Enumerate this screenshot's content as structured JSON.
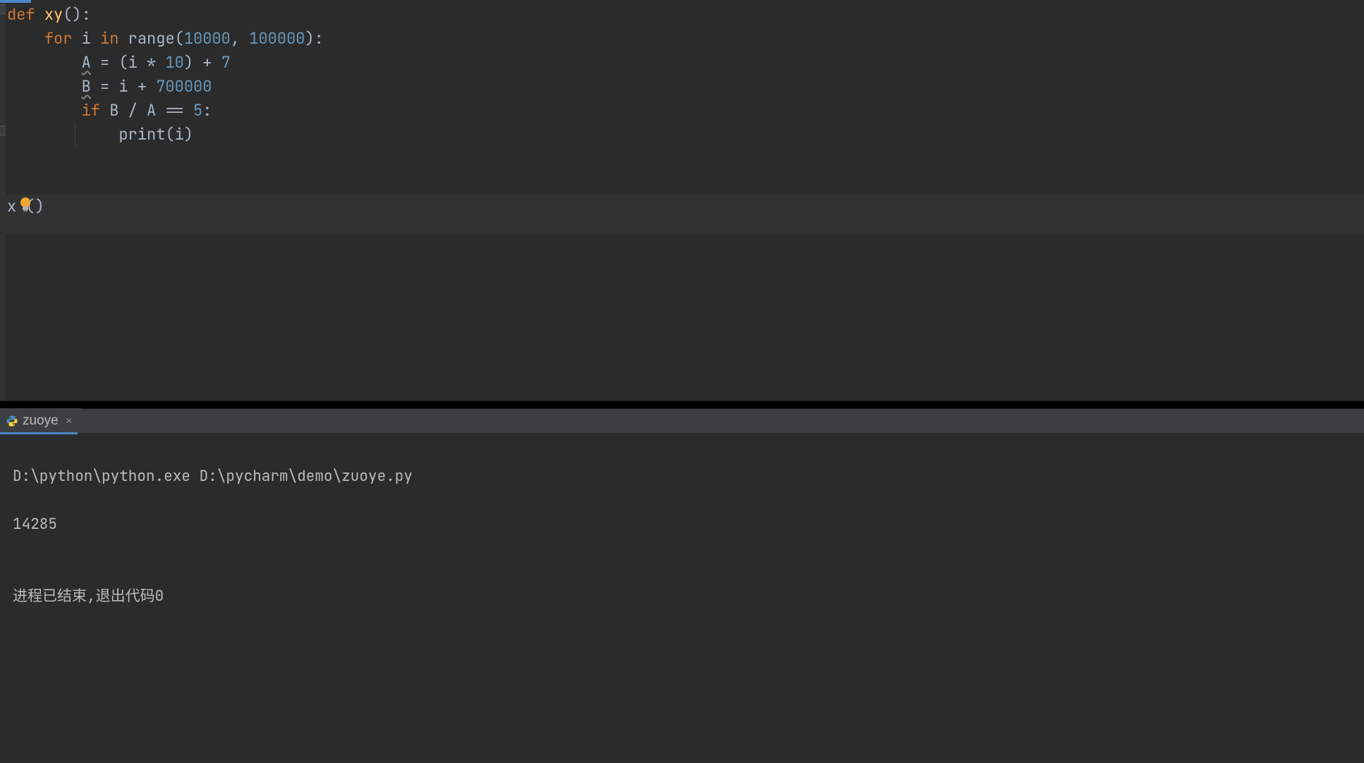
{
  "editor": {
    "code_tokens": [
      [
        {
          "t": "def ",
          "c": "kw"
        },
        {
          "t": "xy",
          "c": "fn"
        },
        {
          "t": "():",
          "c": "var"
        }
      ],
      [
        {
          "t": "    ",
          "c": "var"
        },
        {
          "t": "for ",
          "c": "kw"
        },
        {
          "t": "i ",
          "c": "var"
        },
        {
          "t": "in ",
          "c": "kw"
        },
        {
          "t": "range(",
          "c": "var"
        },
        {
          "t": "10000",
          "c": "num"
        },
        {
          "t": ", ",
          "c": "var"
        },
        {
          "t": "100000",
          "c": "num"
        },
        {
          "t": "):",
          "c": "var"
        }
      ],
      [
        {
          "t": "        ",
          "c": "var"
        },
        {
          "t": "A",
          "c": "var underline-squiggle"
        },
        {
          "t": " = (i * ",
          "c": "var"
        },
        {
          "t": "10",
          "c": "num"
        },
        {
          "t": ") + ",
          "c": "var"
        },
        {
          "t": "7",
          "c": "num"
        }
      ],
      [
        {
          "t": "        ",
          "c": "var"
        },
        {
          "t": "B",
          "c": "var underline-squiggle"
        },
        {
          "t": " = i + ",
          "c": "var"
        },
        {
          "t": "700000",
          "c": "num"
        }
      ],
      [
        {
          "t": "        ",
          "c": "var"
        },
        {
          "t": "if ",
          "c": "kw"
        },
        {
          "t": "B / A == ",
          "c": "var"
        },
        {
          "t": "5",
          "c": "num"
        },
        {
          "t": ":",
          "c": "var"
        }
      ],
      [
        {
          "t": "            ",
          "c": "var"
        },
        {
          "t": "print(i)",
          "c": "var"
        }
      ],
      [
        {
          "t": "",
          "c": "var"
        }
      ],
      [
        {
          "t": "",
          "c": "var"
        }
      ],
      [
        {
          "t": "x ()",
          "c": "var"
        }
      ]
    ]
  },
  "run": {
    "tab_label": "zuoye",
    "output": {
      "command": "D:\\python\\python.exe D:\\pycharm\\demo\\zuoye.py",
      "result": "14285",
      "blank": "",
      "exit": "进程已结束,退出代码0"
    }
  }
}
